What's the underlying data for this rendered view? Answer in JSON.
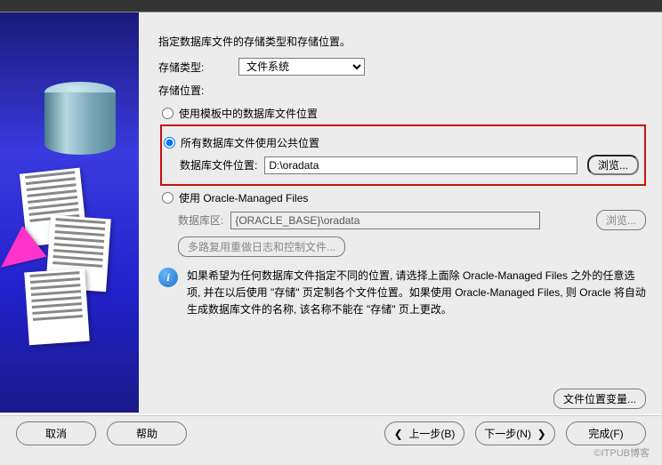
{
  "intro": "指定数据库文件的存储类型和存储位置。",
  "storage_type": {
    "label": "存储类型:",
    "value": "文件系统"
  },
  "location_label": "存储位置:",
  "radios": {
    "template": {
      "label": "使用模板中的数据库文件位置",
      "checked": false
    },
    "common": {
      "label": "所有数据库文件使用公共位置",
      "checked": true,
      "path_label": "数据库文件位置:",
      "path_value": "D:\\oradata",
      "browse": "浏览..."
    },
    "omf": {
      "label": "使用 Oracle-Managed Files",
      "checked": false,
      "area_label": "数据库区:",
      "area_value": "{ORACLE_BASE}\\oradata",
      "browse": "浏览..."
    }
  },
  "multiplex_btn": "多路复用重做日志和控制文件...",
  "info_text": "如果希望为任何数据库文件指定不同的位置, 请选择上面除 Oracle-Managed Files 之外的任意选项, 并在以后使用 \"存储\" 页定制各个文件位置。如果使用 Oracle-Managed Files, 则 Oracle 将自动生成数据库文件的名称, 该名称不能在 \"存储\" 页上更改。",
  "variables_btn": "文件位置变量...",
  "footer": {
    "cancel": "取消",
    "help": "帮助",
    "back": "上一步(B)",
    "next": "下一步(N)",
    "finish": "完成(F)"
  },
  "watermark": "©ITPUB博客"
}
